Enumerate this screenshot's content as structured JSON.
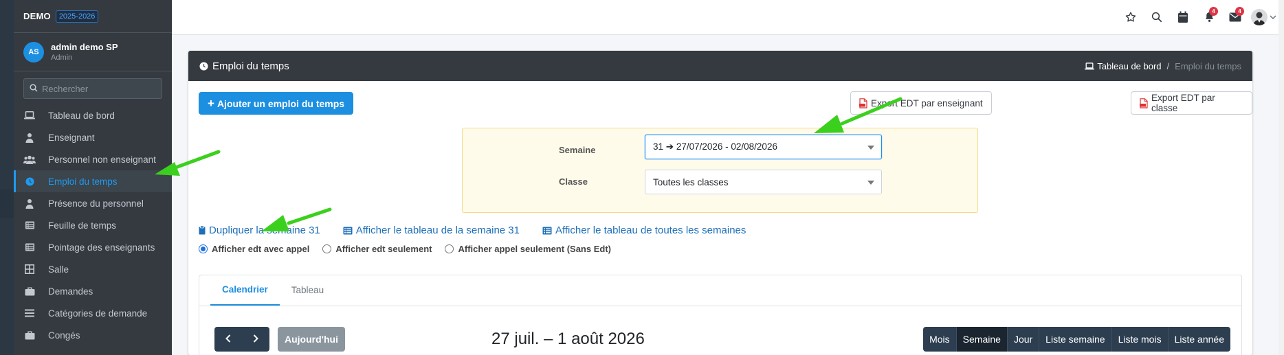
{
  "app": {
    "brand": "DEMO",
    "year_badge": "2025-2026"
  },
  "user": {
    "initials": "AS",
    "name": "admin demo SP",
    "role": "Admin"
  },
  "sidebar": {
    "search_placeholder": "Rechercher",
    "items": [
      {
        "label": "Tableau de bord",
        "icon": "laptop-icon"
      },
      {
        "label": "Enseignant",
        "icon": "teacher-icon"
      },
      {
        "label": "Personnel non enseignant",
        "icon": "users-icon"
      },
      {
        "label": "Emploi du temps",
        "icon": "clock-icon",
        "active": true
      },
      {
        "label": "Présence du personnel",
        "icon": "user-check-icon"
      },
      {
        "label": "Feuille de temps",
        "icon": "list-icon"
      },
      {
        "label": "Pointage des enseignants",
        "icon": "list-icon"
      },
      {
        "label": "Salle",
        "icon": "grid-icon"
      },
      {
        "label": "Demandes",
        "icon": "briefcase-icon"
      },
      {
        "label": "Catégories de demande",
        "icon": "bars-icon"
      },
      {
        "label": "Congés",
        "icon": "briefcase-icon"
      }
    ]
  },
  "topbar": {
    "notif_count": "4",
    "mail_count": "4"
  },
  "page": {
    "title": "Emploi du temps",
    "breadcrumb_home": "Tableau de bord",
    "breadcrumb_sep": "/",
    "breadcrumb_current": "Emploi du temps"
  },
  "actions": {
    "add": "Ajouter un emploi du temps",
    "export_teacher": "Export EDT par enseignant",
    "export_class": "Export EDT par classe"
  },
  "filters": {
    "week_label": "Semaine",
    "week_value": "31  ➔ 27/07/2026 - 02/08/2026",
    "class_label": "Classe",
    "class_value": "Toutes les classes"
  },
  "links": {
    "duplicate": "Dupliquer la semaine 31",
    "show_week": "Afficher le tableau de la semaine 31",
    "show_all": "Afficher le tableau de toutes les semaines"
  },
  "radios": {
    "with_call": "Afficher edt avec appel",
    "edt_only": "Afficher edt seulement",
    "call_only": "Afficher appel seulement (Sans Edt)"
  },
  "tabs": {
    "calendar": "Calendrier",
    "table": "Tableau"
  },
  "calendar": {
    "today": "Aujourd'hui",
    "title": "27 juil. – 1 août 2026",
    "views": [
      "Mois",
      "Semaine",
      "Jour",
      "Liste semaine",
      "Liste mois",
      "Liste année"
    ],
    "active_view": "Semaine"
  },
  "colors": {
    "accent": "#1d8fe1",
    "sidebar": "#343a40",
    "arrow": "#3cd01e",
    "dark_btn": "#2c3e50"
  }
}
